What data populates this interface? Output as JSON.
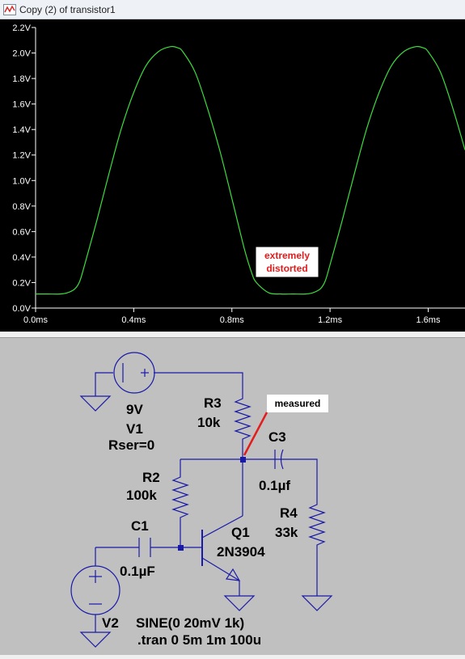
{
  "window": {
    "title": "Copy (2) of transistor1",
    "icon": "waveform-icon"
  },
  "chart_data": {
    "type": "line",
    "ylim": [
      0.0,
      2.2
    ],
    "xlim": [
      0.0,
      1.75
    ],
    "y_ticks": [
      0.0,
      0.2,
      0.4,
      0.6,
      0.8,
      1.0,
      1.2,
      1.4,
      1.6,
      1.8,
      2.0,
      2.2
    ],
    "y_tick_labels": [
      "0.0V",
      "0.2V",
      "0.4V",
      "0.6V",
      "0.8V",
      "1.0V",
      "1.2V",
      "1.4V",
      "1.6V",
      "1.8V",
      "2.0V",
      "2.2V"
    ],
    "x_ticks": [
      0.0,
      0.4,
      0.8,
      1.2,
      1.6
    ],
    "x_tick_labels": [
      "0.0ms",
      "0.4ms",
      "0.8ms",
      "1.2ms",
      "1.6ms"
    ],
    "series": [
      {
        "color": "#3cdc3c",
        "x": [
          0.0,
          0.05,
          0.1,
          0.13,
          0.16,
          0.18,
          0.2,
          0.25,
          0.3,
          0.35,
          0.4,
          0.45,
          0.5,
          0.55,
          0.58,
          0.6,
          0.65,
          0.7,
          0.75,
          0.8,
          0.85,
          0.88,
          0.9,
          0.95,
          1.0,
          1.05,
          1.1,
          1.13,
          1.16,
          1.18,
          1.2,
          1.25,
          1.3,
          1.35,
          1.4,
          1.45,
          1.5,
          1.55,
          1.58,
          1.6,
          1.65,
          1.7,
          1.75
        ],
        "y": [
          0.11,
          0.11,
          0.11,
          0.12,
          0.15,
          0.21,
          0.34,
          0.69,
          1.06,
          1.41,
          1.69,
          1.9,
          2.01,
          2.05,
          2.04,
          2.01,
          1.85,
          1.57,
          1.24,
          0.86,
          0.47,
          0.28,
          0.2,
          0.12,
          0.11,
          0.11,
          0.11,
          0.12,
          0.15,
          0.21,
          0.34,
          0.69,
          1.06,
          1.41,
          1.69,
          1.9,
          2.01,
          2.05,
          2.04,
          2.01,
          1.85,
          1.57,
          1.24
        ]
      }
    ],
    "annotation": {
      "line1": "extremely",
      "line2": "distorted",
      "color": "#e31c1c"
    }
  },
  "schematic": {
    "v1": {
      "value": "9V",
      "name": "V1",
      "param": "Rser=0"
    },
    "r3": {
      "name": "R3",
      "value": "10k"
    },
    "r2": {
      "name": "R2",
      "value": "100k"
    },
    "r4": {
      "name": "R4",
      "value": "33k"
    },
    "c1": {
      "name": "C1",
      "value": "0.1µF"
    },
    "c3": {
      "name": "C3",
      "value": "0.1µf"
    },
    "q1": {
      "name": "Q1",
      "model": "2N3904"
    },
    "v2": {
      "name": "V2",
      "source": "SINE(0 20mV 1k)"
    },
    "directive": ".tran 0 5m 1m 100u",
    "measured_label": "measured",
    "wire_color": "#1a1aa8",
    "annotation_color": "#e31c1c"
  }
}
